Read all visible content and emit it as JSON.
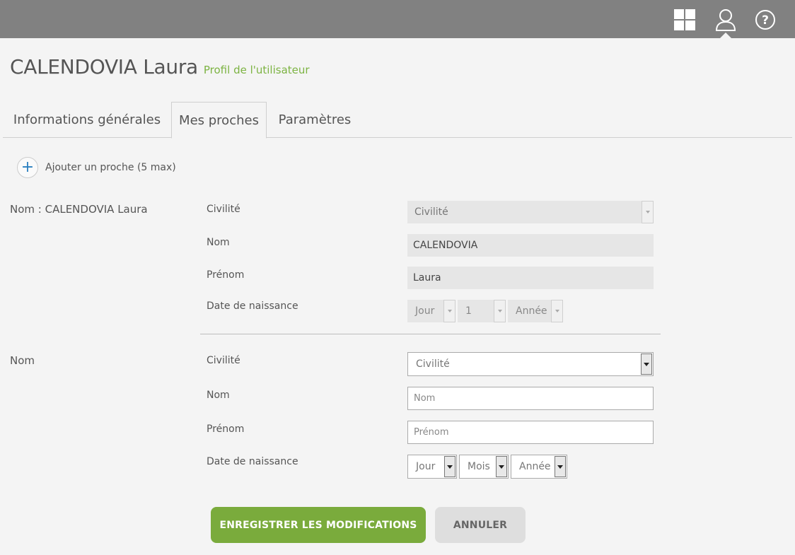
{
  "header": {
    "icons": [
      "grid-icon",
      "user-icon",
      "help-icon"
    ]
  },
  "title": {
    "name": "CALENDOVIA Laura",
    "subtitle": "Profil de l'utilisateur"
  },
  "tabs": [
    {
      "label": "Informations générales",
      "active": false
    },
    {
      "label": "Mes proches",
      "active": true
    },
    {
      "label": "Paramètres",
      "active": false
    }
  ],
  "add_relative": {
    "label": "Ajouter un proche (5 max)"
  },
  "relative_1": {
    "section_label": "Nom : CALENDOVIA Laura",
    "civilite_label": "Civilité",
    "civilite_value": "Civilité",
    "nom_label": "Nom",
    "nom_value": "CALENDOVIA",
    "prenom_label": "Prénom",
    "prenom_value": "Laura",
    "dob_label": "Date de naissance",
    "dob_day": "Jour",
    "dob_month": "1",
    "dob_year": "Année"
  },
  "relative_new": {
    "section_label": "Nom",
    "civilite_label": "Civilité",
    "civilite_value": "Civilité",
    "nom_label": "Nom",
    "nom_placeholder": "Nom",
    "prenom_label": "Prénom",
    "prenom_placeholder": "Prénom",
    "dob_label": "Date de naissance",
    "dob_day": "Jour",
    "dob_month": "Mois",
    "dob_year": "Année"
  },
  "actions": {
    "save": "ENREGISTRER LES MODIFICATIONS",
    "cancel": "ANNULER"
  },
  "colors": {
    "topbar": "#818181",
    "accent_green": "#7aab3c",
    "subtitle_green": "#7cb342",
    "background": "#f4f4f4"
  }
}
